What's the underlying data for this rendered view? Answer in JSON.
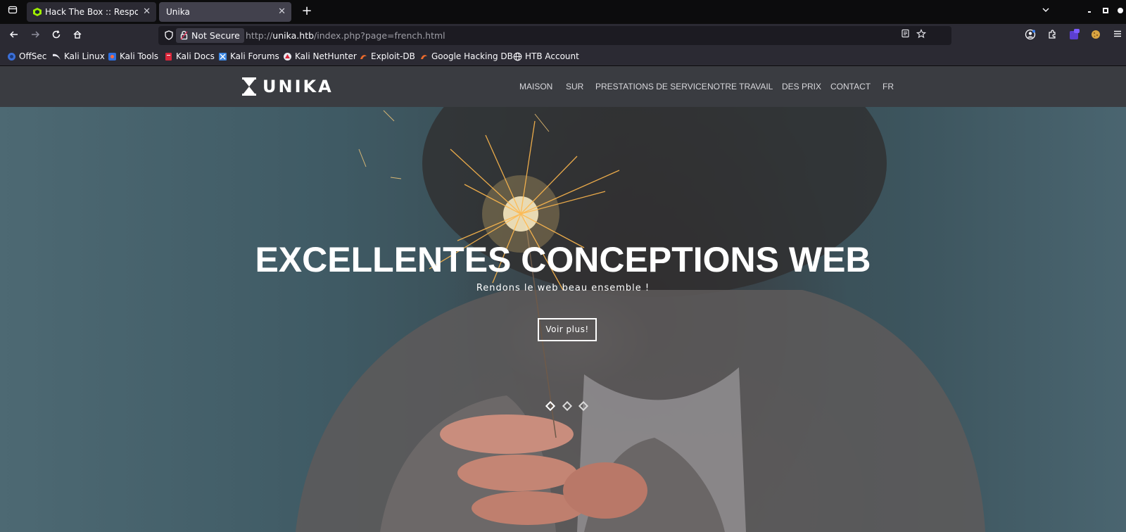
{
  "browser": {
    "tabs": [
      {
        "title": "Hack The Box :: Respond",
        "active": false
      },
      {
        "title": "Unika",
        "active": true
      }
    ],
    "url_bar": {
      "security_label": "Not Secure",
      "url_prefix": "http://",
      "url_host": "unika.htb",
      "url_path": "/index.php?page=french.html"
    },
    "bookmarks": [
      "OffSec",
      "Kali Linux",
      "Kali Tools",
      "Kali Docs",
      "Kali Forums",
      "Kali NetHunter",
      "Exploit-DB",
      "Google Hacking DB",
      "HTB Account"
    ],
    "colors": {
      "tabstrip": "#0c0c0d",
      "toolbar": "#2b2a33",
      "urlbar": "#1c1b22",
      "text": "#fbfbfe"
    }
  },
  "site": {
    "logo": "UNIKA",
    "menu": [
      "MAISON",
      "SUR",
      "PRESTATIONS DE SERVICE",
      "NOTRE TRAVAIL",
      "DES PRIX",
      "CONTACT",
      "FR"
    ],
    "hero": {
      "title": "EXCELLENTES CONCEPTIONS WEB",
      "subtitle": "Rendons le web beau ensemble !",
      "button": "Voir plus!"
    },
    "slider_active_index": 0,
    "colors": {
      "header": "#3a3c41",
      "hero_text": "#ffffff"
    }
  }
}
